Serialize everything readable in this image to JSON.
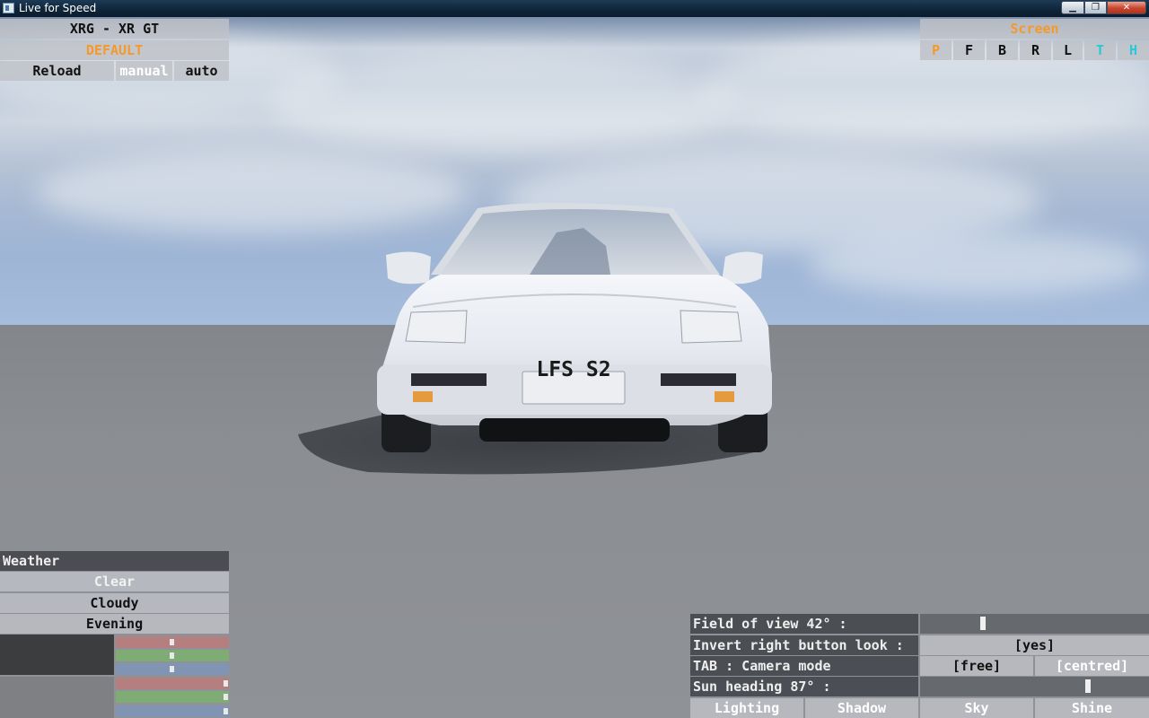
{
  "window": {
    "title": "Live for Speed"
  },
  "car_panel": {
    "car_name": "XRG - XR GT",
    "setup_name": "DEFAULT",
    "reload_label": "Reload",
    "manual_label": "manual",
    "auto_label": "auto"
  },
  "screen_panel": {
    "title": "Screen",
    "views": [
      "P",
      "F",
      "B",
      "R",
      "L",
      "T",
      "H"
    ]
  },
  "weather_panel": {
    "title": "Weather",
    "options": [
      "Clear",
      "Cloudy",
      "Evening"
    ],
    "color_sliders": [
      {
        "channel": "red",
        "value": 0.5
      },
      {
        "channel": "green",
        "value": 0.5
      },
      {
        "channel": "blue",
        "value": 0.5
      },
      {
        "channel": "red",
        "value": 1.0
      },
      {
        "channel": "green",
        "value": 1.0
      },
      {
        "channel": "blue",
        "value": 1.0
      }
    ]
  },
  "camera_panel": {
    "fov_label": "Field of view 42° :",
    "fov_value": 0.27,
    "invert_label": "Invert right button look :",
    "invert_value": "[yes]",
    "tab_label": "TAB : Camera mode",
    "mode_free": "[free]",
    "mode_centred": "[centred]",
    "sun_label": "Sun heading 87° :",
    "sun_value": 0.74,
    "tabs": [
      "Lighting",
      "Shadow",
      "Sky",
      "Shine"
    ]
  },
  "car": {
    "plate": "LFS S2"
  },
  "colors": {
    "accent_orange": "#f39a2a",
    "accent_cyan": "#28c8d8",
    "panel_light": "#bec1c7",
    "panel_dark": "#404248"
  }
}
